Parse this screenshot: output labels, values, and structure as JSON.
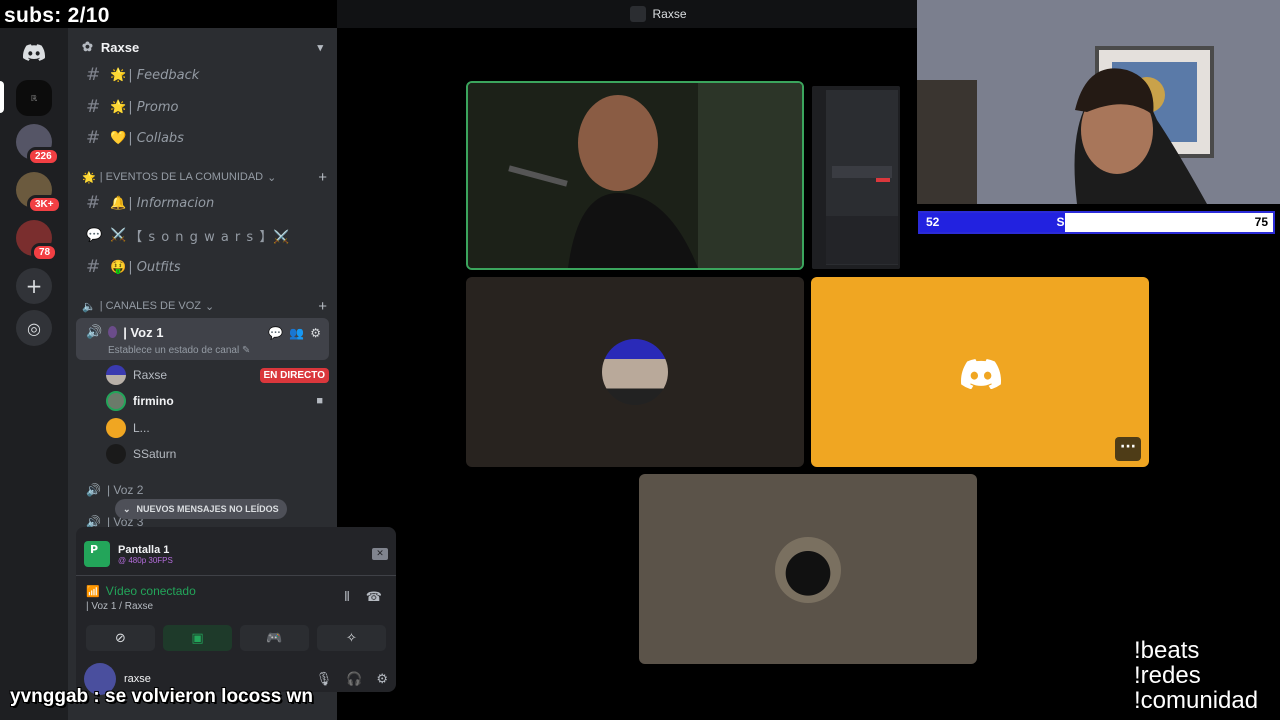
{
  "overlay": {
    "subs": "subs: 2/10",
    "followers": {
      "current": "52",
      "label": "SEGUIDORES",
      "goal": "75",
      "fill_fraction": 0.41
    },
    "commands": [
      "!beats",
      "!redes",
      "!comunidad"
    ],
    "chat": {
      "user": "yvnggab",
      "separator": ":",
      "message": "se volvieron locoss wn"
    }
  },
  "window": {
    "title": "Raxse"
  },
  "rail": {
    "badges": [
      "226",
      "3K+",
      "78"
    ],
    "icons": [
      "discord-home-icon",
      "add-server-icon",
      "explore-icon"
    ]
  },
  "server": {
    "name": "Raxse",
    "channels": [
      {
        "emoji": "🌟",
        "name": "| Feedback"
      },
      {
        "emoji": "🌟",
        "name": "| Promo"
      },
      {
        "emoji": "💛",
        "name": "| Collabs"
      }
    ],
    "category_events": "| EVENTOS DE LA COMUNIDAD",
    "event_channels": [
      {
        "emoji": "🔔",
        "name": "| Informacion"
      },
      {
        "emoji": "⚔️",
        "name": "【 s o n g w a r s 】⚔️"
      },
      {
        "emoji": "🤑",
        "name": "| Outfits"
      }
    ],
    "category_voice": "| CANALES DE VOZ",
    "voice_active": {
      "name": "| Voz 1",
      "status": "Establece un estado de canal"
    },
    "voice_users": [
      {
        "name": "Raxse",
        "badge": "EN DIRECTO"
      },
      {
        "name": "firmino"
      },
      {
        "name": "L..."
      },
      {
        "name": "SSaturn"
      }
    ],
    "voice_other": [
      "| Voz 2",
      "| Voz 3"
    ],
    "unread_banner": "NUEVOS MENSAJES NO LEÍDOS"
  },
  "panel": {
    "stream_title": "Pantalla 1",
    "stream_quality": "@ 480p 30FPS",
    "stream_icon_letter": "P",
    "video_status": "Vídeo conectado",
    "video_channel": "| Voz 1 / Raxse",
    "username": "raxse"
  },
  "colors": {
    "discord_yellow": "#f0a622",
    "live_red": "#da373c",
    "connected_green": "#23a55a",
    "follower_bar": "#2222e0"
  }
}
